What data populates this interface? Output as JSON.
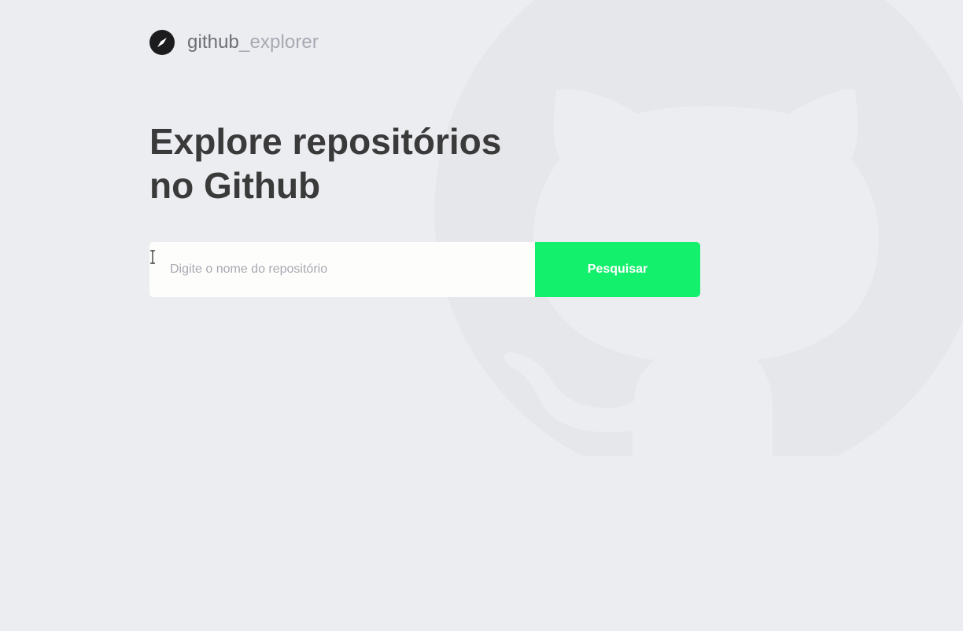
{
  "app": {
    "brand": {
      "name_part1": "github",
      "name_part2": "_explorer",
      "icon": "compass-icon"
    },
    "background_icon": "github-octocat-icon"
  },
  "hero": {
    "title": "Explore repositórios no Github"
  },
  "search": {
    "placeholder": "Digite o nome do repositório",
    "value": "",
    "button_label": "Pesquisar"
  },
  "colors": {
    "background": "#ecedf1",
    "title": "#3a3a3a",
    "brand_dark": "#6e6e76",
    "brand_light": "#a8a8b3",
    "accent": "#12f06c",
    "input_bg": "#fdfdfb"
  }
}
